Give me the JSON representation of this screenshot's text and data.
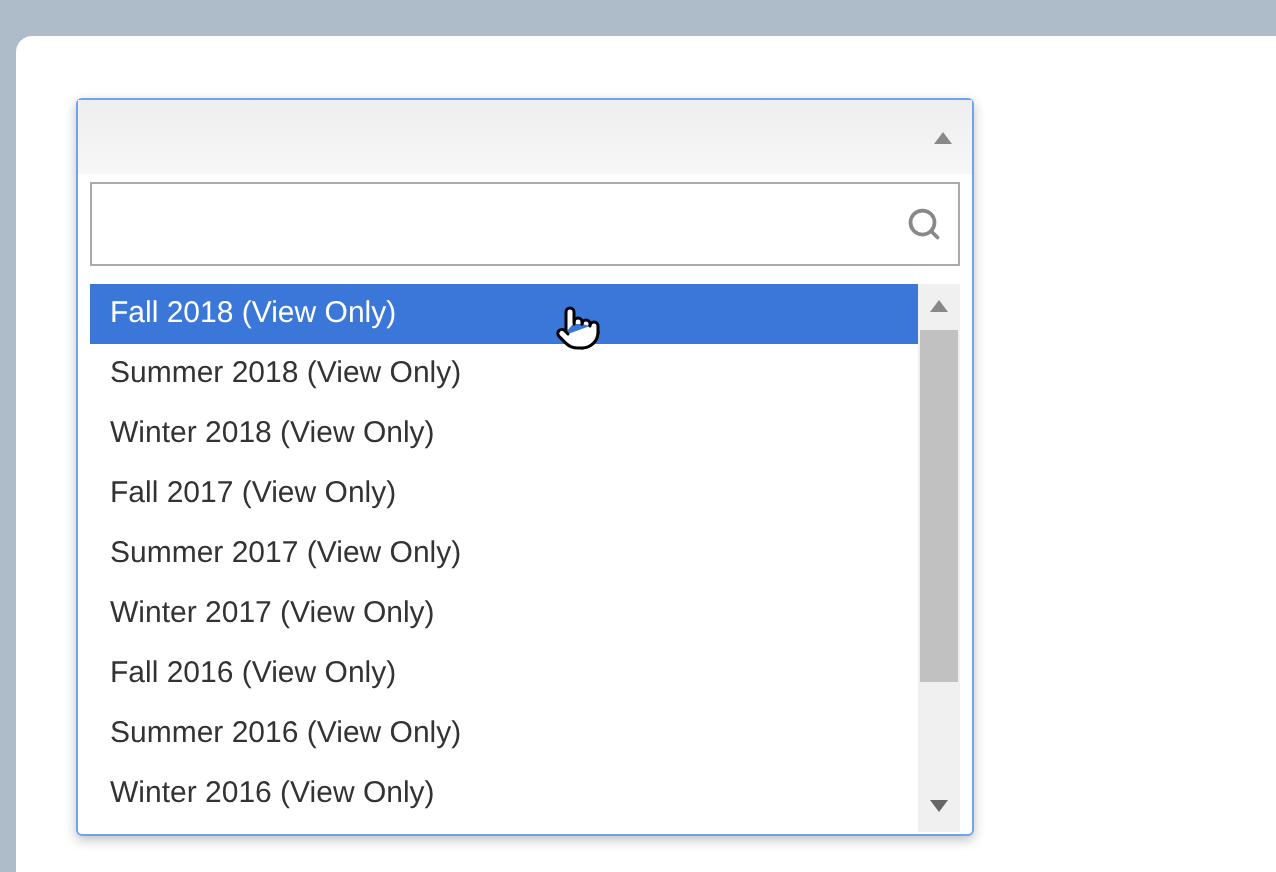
{
  "options": [
    {
      "label": "Fall 2018 (View Only)",
      "selected": true
    },
    {
      "label": "Summer 2018 (View Only)",
      "selected": false
    },
    {
      "label": "Winter 2018 (View Only)",
      "selected": false
    },
    {
      "label": "Fall 2017 (View Only)",
      "selected": false
    },
    {
      "label": "Summer 2017 (View Only)",
      "selected": false
    },
    {
      "label": "Winter 2017 (View Only)",
      "selected": false
    },
    {
      "label": "Fall 2016 (View Only)",
      "selected": false
    },
    {
      "label": "Summer 2016 (View Only)",
      "selected": false
    },
    {
      "label": "Winter 2016 (View Only)",
      "selected": false
    }
  ]
}
